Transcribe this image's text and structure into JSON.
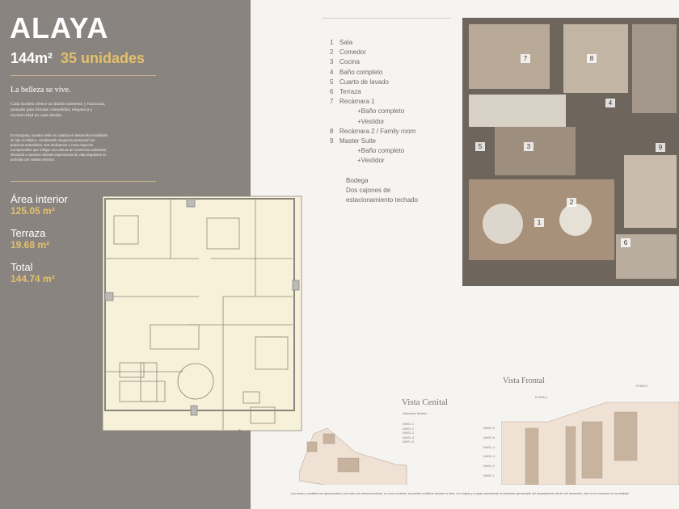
{
  "header": {
    "title": "ALAYA",
    "size": "144m²",
    "units": "35 unidades"
  },
  "intro": {
    "tagline": "La belleza se vive.",
    "paragraph1": "Cada modelo ofrece un diseño moderno y funcional, pensado para brindar comodidad, elegancia y exclusividad en cada detalle.",
    "paragraph2": "En Europarq, nuestra visión es catalizar el desarrollo inmobiliario de lujo en México, combinando elegancia atemporal con prácticas sostenibles. Nos dedicamos a crear espacios excepcionales que reflejan una cultura de excelencia ambiental, elevando a nuestros clientes experiencias de vida singulares en armonía con nuestro entorno."
  },
  "areas": [
    {
      "label": "Área interior",
      "value": "125.05 m²"
    },
    {
      "label": "Terraza",
      "value": "19.68 m²"
    },
    {
      "label": "Total",
      "value": "144.74 m²"
    }
  ],
  "legend": {
    "items": [
      {
        "n": "1",
        "label": "Sala"
      },
      {
        "n": "2",
        "label": "Comedor"
      },
      {
        "n": "3",
        "label": "Cocina"
      },
      {
        "n": "4",
        "label": "Baño completo"
      },
      {
        "n": "5",
        "label": "Cuarto de lavado"
      },
      {
        "n": "6",
        "label": "Terraza"
      },
      {
        "n": "7",
        "label": "Recámara 1"
      }
    ],
    "r7_extras": [
      "+Baño completo",
      "+Vestidor"
    ],
    "items2": [
      {
        "n": "8",
        "label": "Recámara 2 / Family room"
      },
      {
        "n": "9",
        "label": "Master Suite"
      }
    ],
    "r9_extras": [
      "+Baño completo",
      "+Vestidor"
    ],
    "extras": [
      "Bodega",
      "Dos cajones de",
      "estacionamiento techado"
    ]
  },
  "render_labels": [
    "1",
    "2",
    "3",
    "4",
    "5",
    "6",
    "7",
    "8",
    "9"
  ],
  "vista_cenital": {
    "title": "Vista Cenital",
    "subtitle": "Ubicación Modelo",
    "levels": [
      "NIVEL 1",
      "NIVEL 2",
      "NIVEL 3",
      "NIVEL 4",
      "NIVEL 5"
    ]
  },
  "vista_frontal": {
    "title": "Vista Frontal",
    "etapa2": "ETAPA 2",
    "etapa1": "ETAPA 1",
    "levels": [
      "NIVEL 6",
      "NIVEL 5",
      "NIVEL 4",
      "NIVEL 3",
      "NIVEL 2",
      "NIVEL 1"
    ]
  },
  "footer": "Las áreas y medidas son aproximadas y son sólo una referencia visual, no como contrato; se pueden modificar durante la obra. Los mapas y croquis representan la ubicación aproximada del departamento dentro del desarrollo, esto no es necesario en la realidad."
}
